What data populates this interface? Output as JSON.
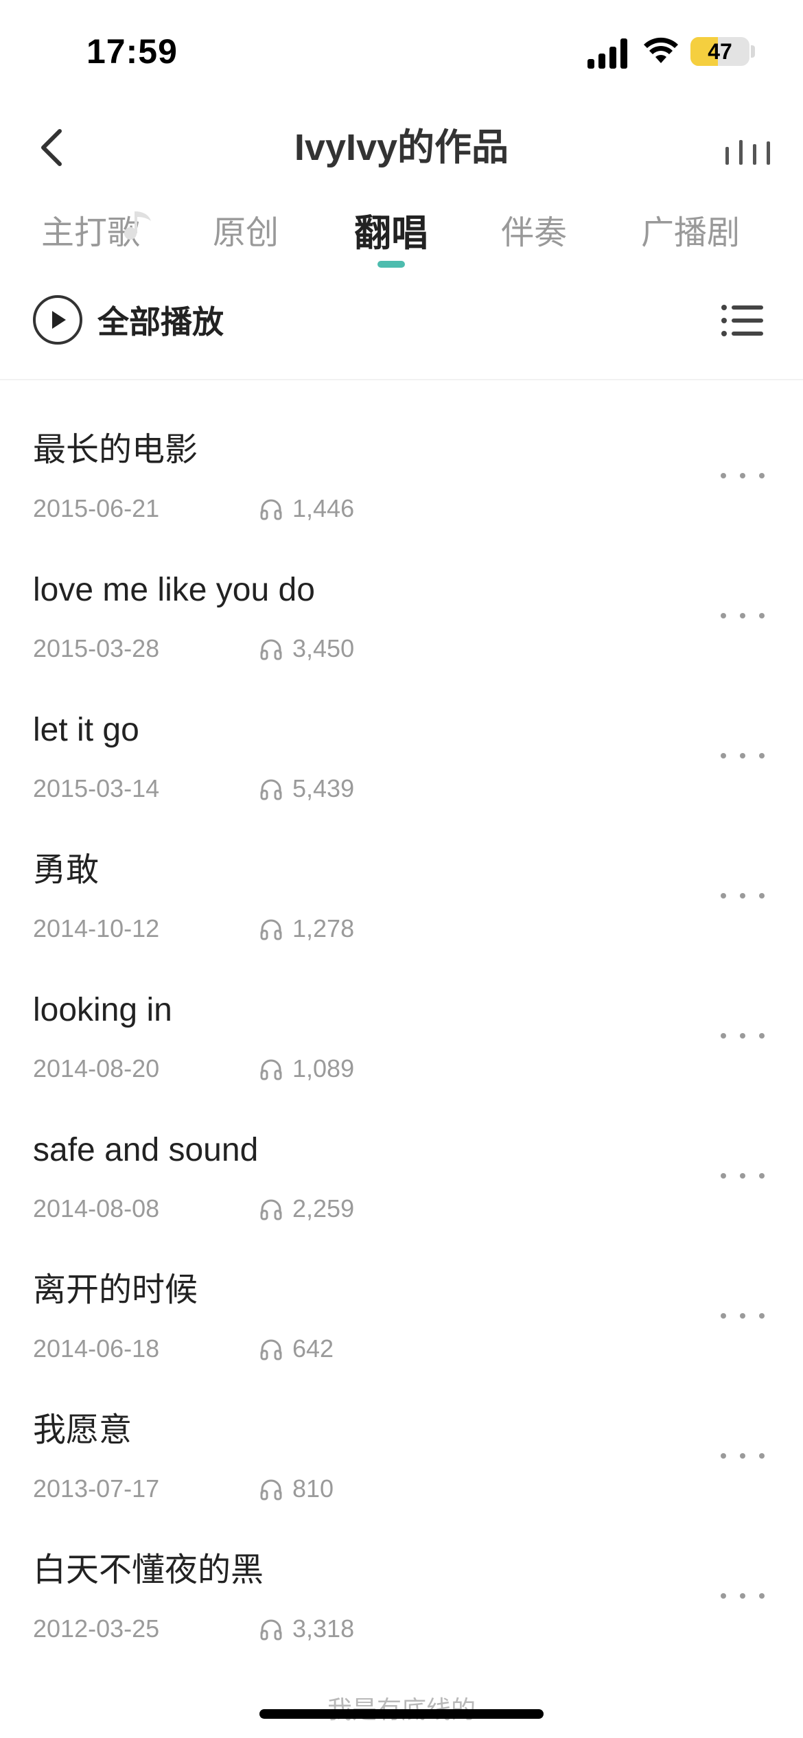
{
  "status_bar": {
    "time": "17:59",
    "battery": "47",
    "battery_level": 0.47
  },
  "header": {
    "title": "IvyIvy的作品"
  },
  "tabs": [
    {
      "label": "主打歌",
      "active": false
    },
    {
      "label": "原创",
      "active": false
    },
    {
      "label": "翻唱",
      "active": true
    },
    {
      "label": "伴奏",
      "active": false
    },
    {
      "label": "广播剧",
      "active": false
    }
  ],
  "toolbar": {
    "play_all_label": "全部播放"
  },
  "songs": [
    {
      "title": "最长的电影",
      "date": "2015-06-21",
      "plays": "1,446"
    },
    {
      "title": "love me like you do",
      "date": "2015-03-28",
      "plays": "3,450"
    },
    {
      "title": "let it go",
      "date": "2015-03-14",
      "plays": "5,439"
    },
    {
      "title": "勇敢",
      "date": "2014-10-12",
      "plays": "1,278"
    },
    {
      "title": "looking in",
      "date": "2014-08-20",
      "plays": "1,089"
    },
    {
      "title": "safe and sound",
      "date": "2014-08-08",
      "plays": "2,259"
    },
    {
      "title": "离开的时候",
      "date": "2014-06-18",
      "plays": "642"
    },
    {
      "title": "我愿意",
      "date": "2013-07-17",
      "plays": "810"
    },
    {
      "title": "白天不懂夜的黑",
      "date": "2012-03-25",
      "plays": "3,318"
    }
  ],
  "footer": {
    "text": "我是有底线的"
  },
  "colors": {
    "accent": "#4dbcae",
    "battery": "#f5cf3f",
    "secondary_text": "#9a9a9a"
  }
}
